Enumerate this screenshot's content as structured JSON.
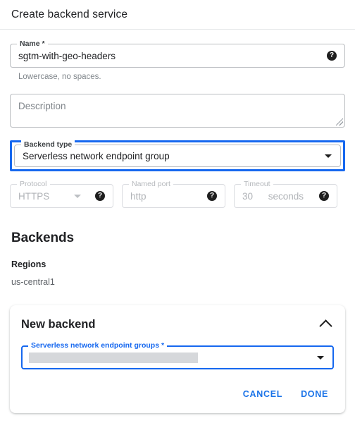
{
  "header": {
    "title": "Create backend service"
  },
  "form": {
    "name": {
      "label": "Name *",
      "value": "sgtm-with-geo-headers",
      "hint": "Lowercase, no spaces.",
      "help_glyph": "?"
    },
    "description": {
      "placeholder": "Description"
    },
    "backend_type": {
      "label": "Backend type",
      "value": "Serverless network endpoint group",
      "highlighted": true
    },
    "protocol": {
      "label": "Protocol",
      "value": "HTTPS",
      "help_glyph": "?",
      "disabled": true
    },
    "named_port": {
      "label": "Named port",
      "value": "http",
      "help_glyph": "?",
      "disabled": true
    },
    "timeout": {
      "label": "Timeout",
      "value": "30",
      "suffix": "seconds",
      "help_glyph": "?",
      "disabled": true
    }
  },
  "backends": {
    "section_title": "Backends",
    "regions_label": "Regions",
    "regions_value": "us-central1",
    "card": {
      "title": "New backend",
      "collapse_icon": "chevron-up",
      "sneg": {
        "label": "Serverless network endpoint groups *",
        "value": ""
      },
      "cancel_label": "CANCEL",
      "done_label": "DONE"
    }
  },
  "colors": {
    "accent_blue": "#1a73e8",
    "highlight_blue": "#1668ef",
    "text_primary": "#202124",
    "text_muted": "#80868b",
    "disabled_text": "#b0b3b7",
    "redaction_grey": "#d6d8db"
  }
}
